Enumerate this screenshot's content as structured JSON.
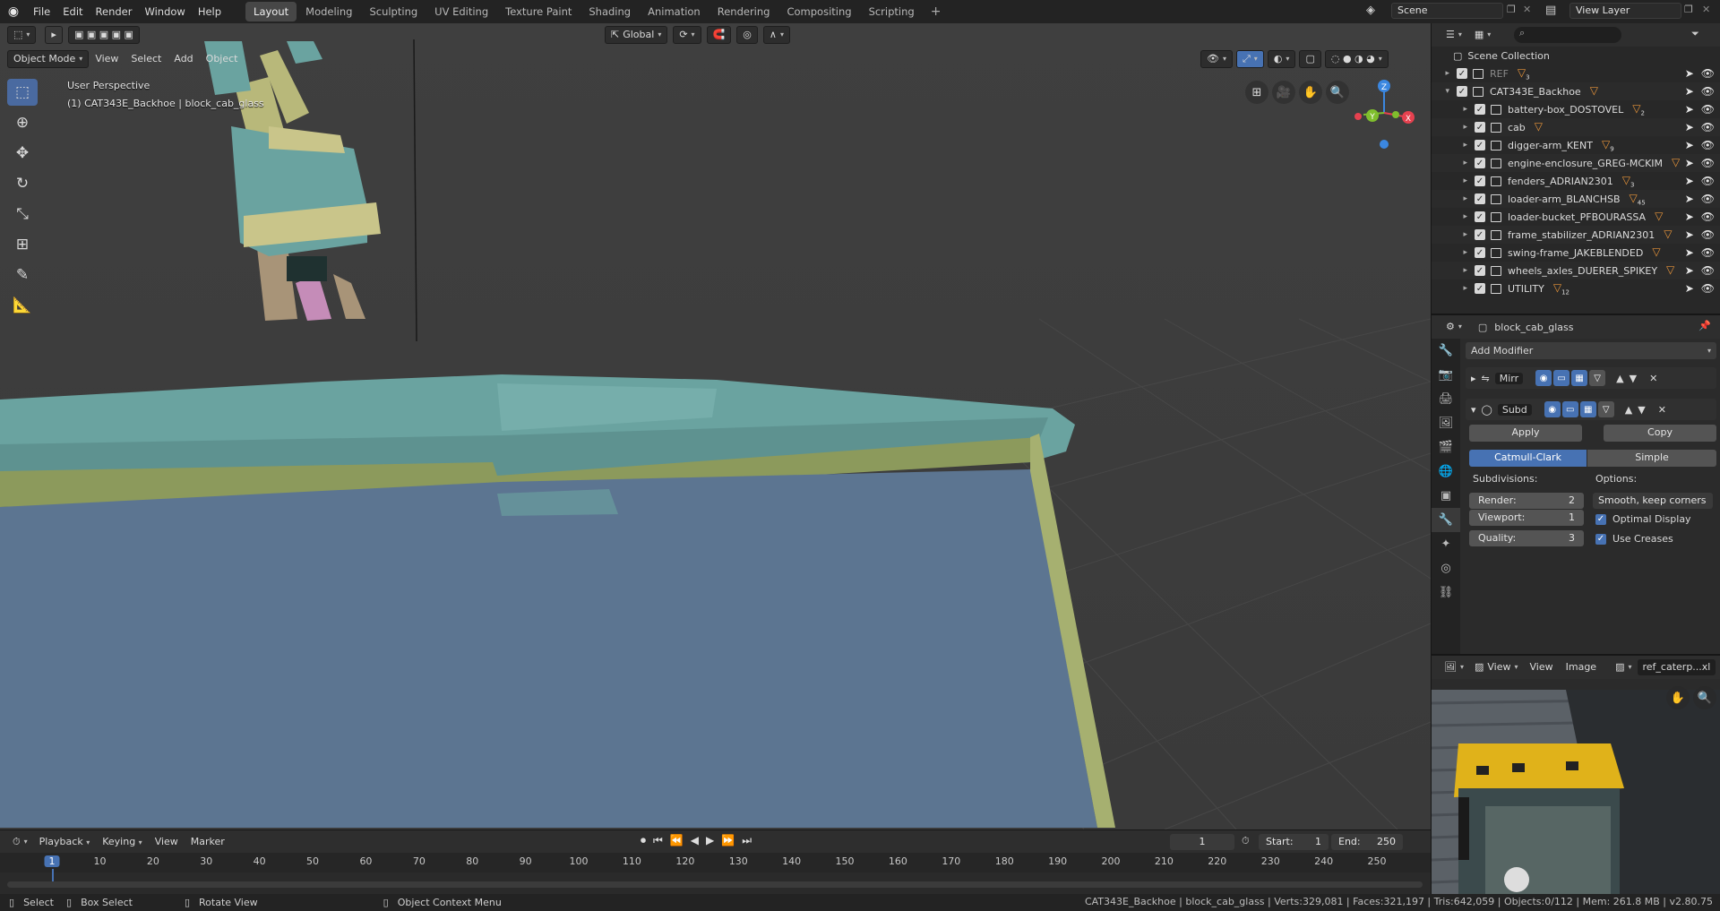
{
  "topbar": {
    "menus": [
      "File",
      "Edit",
      "Render",
      "Window",
      "Help"
    ],
    "workspaces": [
      "Layout",
      "Modeling",
      "Sculpting",
      "UV Editing",
      "Texture Paint",
      "Shading",
      "Animation",
      "Rendering",
      "Compositing",
      "Scripting"
    ],
    "active_workspace": "Layout",
    "add_workspace": "+",
    "scene": "Scene",
    "view_layer": "View Layer"
  },
  "viewport": {
    "mode": "Object Mode",
    "menus": [
      "View",
      "Select",
      "Add",
      "Object"
    ],
    "transform_orientation": "Global",
    "perspective_label": "User Perspective",
    "object_label": "(1) CAT343E_Backhoe | block_cab_glass",
    "gizmo_axes": {
      "z": "Z",
      "y": "Y",
      "x": "X"
    },
    "colors": {
      "axis_x": "#e5414f",
      "axis_y": "#7fbe2d",
      "axis_z": "#3b87e0",
      "cab_teal": "#6aa3a0",
      "frame_olive": "#8c9a5c",
      "glass_blue": "#5c7591"
    }
  },
  "timeline": {
    "menus": [
      "Playback",
      "Keying",
      "View",
      "Marker"
    ],
    "current_frame": "1",
    "start_label": "Start:",
    "start": "1",
    "end_label": "End:",
    "end": "250",
    "ruler": [
      "1",
      "10",
      "20",
      "30",
      "40",
      "50",
      "60",
      "70",
      "80",
      "90",
      "100",
      "110",
      "120",
      "130",
      "140",
      "150",
      "160",
      "170",
      "180",
      "190",
      "200",
      "210",
      "220",
      "230",
      "240",
      "250"
    ]
  },
  "statusbar": {
    "select": "Select",
    "box_select": "Box Select",
    "rotate_view": "Rotate View",
    "context_menu": "Object Context Menu",
    "stats": "CAT343E_Backhoe | block_cab_glass | Verts:329,081 | Faces:321,197 | Tris:642,059 | Objects:0/112 | Mem: 261.8 MB | v2.80.75"
  },
  "outliner": {
    "root": "Scene Collection",
    "items": [
      {
        "name": "REF",
        "badge": "3",
        "dim": true
      },
      {
        "name": "CAT343E_Backhoe",
        "badge": "",
        "dim": false
      },
      {
        "name": "battery-box_DOSTOVEL",
        "badge": "2",
        "dim": false
      },
      {
        "name": "cab",
        "badge": "",
        "dim": false
      },
      {
        "name": "digger-arm_KENT",
        "badge": "9",
        "dim": false
      },
      {
        "name": "engine-enclosure_GREG-MCKIM",
        "badge": "",
        "dim": false
      },
      {
        "name": "fenders_ADRIAN2301",
        "badge": "3",
        "dim": false
      },
      {
        "name": "loader-arm_BLANCHSB",
        "badge": "45",
        "dim": false
      },
      {
        "name": "loader-bucket_PFBOURASSA",
        "badge": "",
        "dim": false
      },
      {
        "name": "frame_stabilizer_ADRIAN2301",
        "badge": "",
        "dim": false
      },
      {
        "name": "swing-frame_JAKEBLENDED",
        "badge": "",
        "dim": false
      },
      {
        "name": "wheels_axles_DUERER_SPIKEY",
        "badge": "",
        "dim": false
      },
      {
        "name": "UTILITY",
        "badge": "12",
        "dim": false
      }
    ]
  },
  "properties": {
    "object_name": "block_cab_glass",
    "add_modifier": "Add Modifier",
    "modifiers": [
      {
        "name": "Mirr"
      },
      {
        "name": "Subd"
      }
    ],
    "apply": "Apply",
    "copy": "Copy",
    "algo_catmull": "Catmull-Clark",
    "algo_simple": "Simple",
    "subdivisions_label": "Subdivisions:",
    "options_label": "Options:",
    "render_label": "Render:",
    "render_value": "2",
    "viewport_label": "Viewport:",
    "viewport_value": "1",
    "quality_label": "Quality:",
    "quality_value": "3",
    "smooth_option": "Smooth, keep corners",
    "optimal_display": "Optimal Display",
    "use_creases": "Use Creases"
  },
  "image_editor": {
    "menus": [
      "View",
      "View",
      "Image"
    ],
    "image_name": "ref_caterp...xl"
  }
}
